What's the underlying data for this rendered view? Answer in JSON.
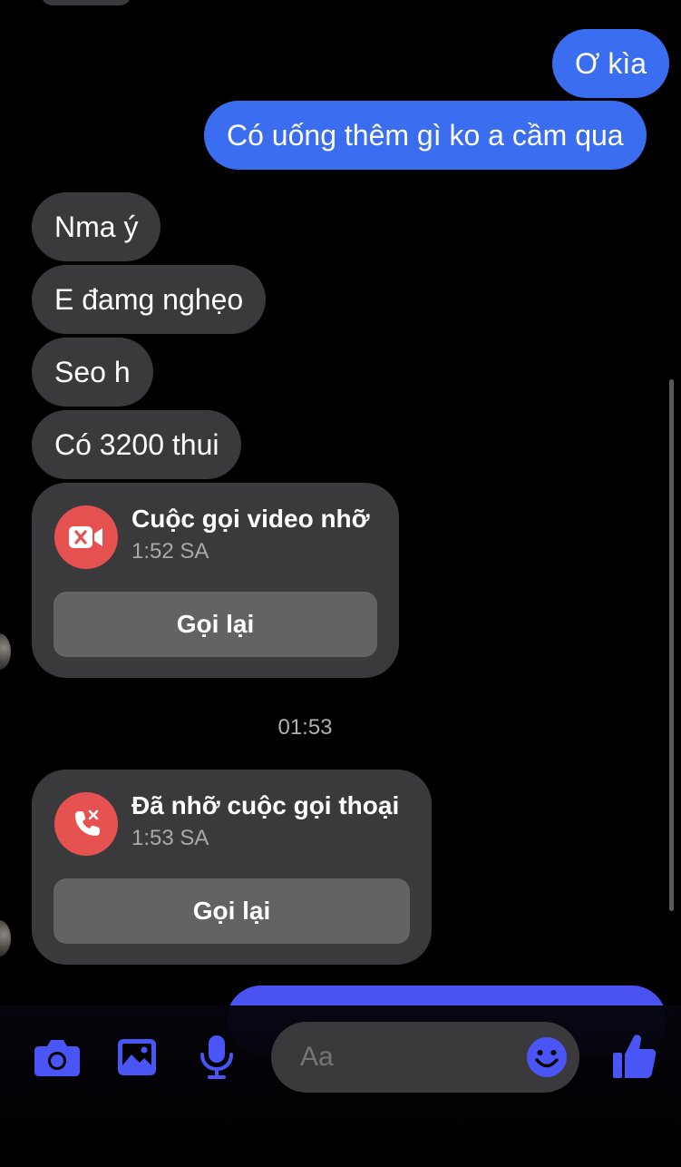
{
  "colors": {
    "background": "#000000",
    "outgoing_bubble": "#3a6df0",
    "incoming_bubble": "#3a3a3c",
    "missed_call_red": "#e5524f",
    "accent_icons": "#4a55f5"
  },
  "messages": {
    "out_1": "Ơ kìa",
    "out_2": "Có uống thêm gì ko a cầm qua",
    "in_1": "Nma ý",
    "in_2": "E đamg nghẹo",
    "in_3": "Seo h",
    "in_4": "Có 3200 thui"
  },
  "calls": {
    "video": {
      "title": "Cuộc gọi video nhỡ",
      "time": "1:52 SA",
      "button": "Gọi lại",
      "icon": "missed-video-call-icon"
    },
    "voice": {
      "title": "Đã nhỡ cuộc gọi thoại",
      "time": "1:53 SA",
      "button": "Gọi lại",
      "icon": "missed-voice-call-icon"
    }
  },
  "timestamp": "01:53",
  "composer": {
    "placeholder": "Aa",
    "icons": [
      "camera-icon",
      "image-icon",
      "microphone-icon",
      "emoji-icon",
      "thumbs-up-icon"
    ]
  }
}
